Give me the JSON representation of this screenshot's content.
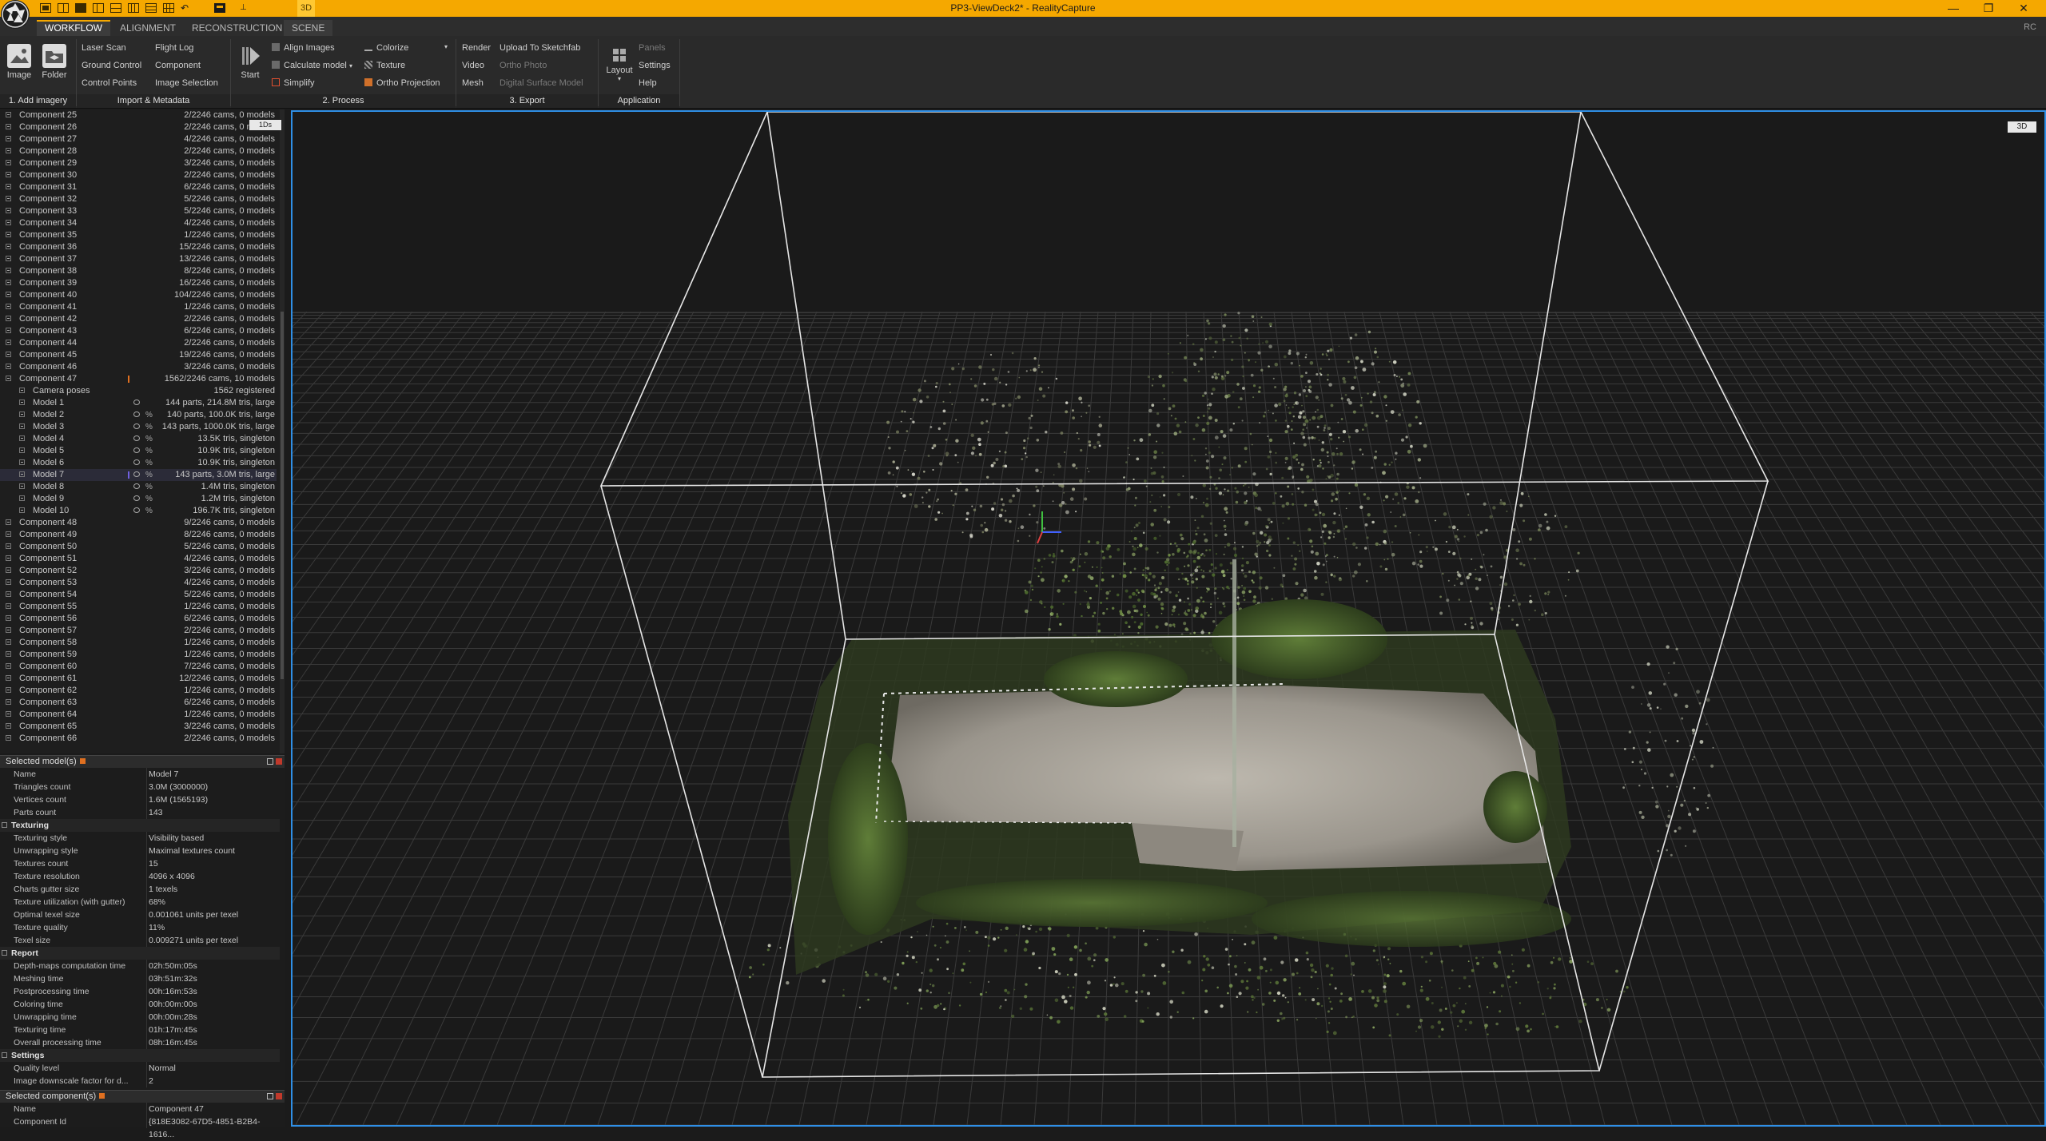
{
  "window": {
    "title": "PP3-ViewDeck2* - RealityCapture",
    "view_mode": "3D"
  },
  "tabs": [
    "WORKFLOW",
    "ALIGNMENT",
    "RECONSTRUCTION",
    "SCENE"
  ],
  "active_tab": "WORKFLOW",
  "rc_label": "RC",
  "ribbon": {
    "add_imagery": {
      "image": "Image",
      "folder": "Folder",
      "label": "1. Add imagery"
    },
    "import_metadata": {
      "col1": [
        "Laser Scan",
        "Ground Control",
        "Control Points"
      ],
      "col2": [
        "Flight Log",
        "Component",
        "Image Selection"
      ],
      "label": "Import & Metadata"
    },
    "process": {
      "start": "Start",
      "col1": [
        "Align Images",
        "Calculate model",
        "Simplify"
      ],
      "col2": [
        "Colorize",
        "Texture",
        "Ortho Projection"
      ],
      "label": "2. Process"
    },
    "export": {
      "col1": [
        "Render",
        "Video",
        "Mesh"
      ],
      "col2": [
        "Upload To Sketchfab",
        "Ortho Photo",
        "Digital Surface Model"
      ],
      "label": "3. Export"
    },
    "application": {
      "layout": "Layout",
      "col": [
        "Panels",
        "Settings",
        "Help"
      ],
      "label": "Application"
    }
  },
  "tree": {
    "badge": "1Ds",
    "rows": [
      {
        "name": "Component 25",
        "value": "2/2246 cams, 0 models"
      },
      {
        "name": "Component 26",
        "value": "2/2246 cams, 0 models"
      },
      {
        "name": "Component 27",
        "value": "4/2246 cams, 0 models"
      },
      {
        "name": "Component 28",
        "value": "2/2246 cams, 0 models"
      },
      {
        "name": "Component 29",
        "value": "3/2246 cams, 0 models"
      },
      {
        "name": "Component 30",
        "value": "2/2246 cams, 0 models"
      },
      {
        "name": "Component 31",
        "value": "6/2246 cams, 0 models"
      },
      {
        "name": "Component 32",
        "value": "5/2246 cams, 0 models"
      },
      {
        "name": "Component 33",
        "value": "5/2246 cams, 0 models"
      },
      {
        "name": "Component 34",
        "value": "4/2246 cams, 0 models"
      },
      {
        "name": "Component 35",
        "value": "1/2246 cams, 0 models"
      },
      {
        "name": "Component 36",
        "value": "15/2246 cams, 0 models"
      },
      {
        "name": "Component 37",
        "value": "13/2246 cams, 0 models"
      },
      {
        "name": "Component 38",
        "value": "8/2246 cams, 0 models"
      },
      {
        "name": "Component 39",
        "value": "16/2246 cams, 0 models"
      },
      {
        "name": "Component 40",
        "value": "104/2246 cams, 0 models"
      },
      {
        "name": "Component 41",
        "value": "1/2246 cams, 0 models"
      },
      {
        "name": "Component 42",
        "value": "2/2246 cams, 0 models"
      },
      {
        "name": "Component 43",
        "value": "6/2246 cams, 0 models"
      },
      {
        "name": "Component 44",
        "value": "2/2246 cams, 0 models"
      },
      {
        "name": "Component 45",
        "value": "19/2246 cams, 0 models"
      },
      {
        "name": "Component 46",
        "value": "3/2246 cams, 0 models"
      },
      {
        "name": "Component 47",
        "value": "1562/2246 cams, 10 models"
      },
      {
        "name": "Camera poses",
        "value": "1562 registered",
        "sub": true
      },
      {
        "name": "Model 1",
        "value": "144 parts, 214.8M tris, large",
        "sub": true,
        "eye": true
      },
      {
        "name": "Model 2",
        "value": "140 parts, 100.0K tris, large",
        "sub": true,
        "eye": true,
        "pct": true
      },
      {
        "name": "Model 3",
        "value": "143 parts, 1000.0K tris, large",
        "sub": true,
        "eye": true,
        "pct": true
      },
      {
        "name": "Model 4",
        "value": "13.5K tris, singleton",
        "sub": true,
        "eye": true,
        "pct": true
      },
      {
        "name": "Model 5",
        "value": "10.9K tris, singleton",
        "sub": true,
        "eye": true,
        "pct": true
      },
      {
        "name": "Model 6",
        "value": "10.9K tris, singleton",
        "sub": true,
        "eye": true,
        "pct": true
      },
      {
        "name": "Model 7",
        "value": "143 parts, 3.0M tris, large",
        "sub": true,
        "eye": true,
        "pct": true,
        "selected": true
      },
      {
        "name": "Model 8",
        "value": "1.4M tris, singleton",
        "sub": true,
        "eye": true,
        "pct": true
      },
      {
        "name": "Model 9",
        "value": "1.2M tris, singleton",
        "sub": true,
        "eye": true,
        "pct": true
      },
      {
        "name": "Model 10",
        "value": "196.7K tris, singleton",
        "sub": true,
        "eye": true,
        "pct": true
      },
      {
        "name": "Component 48",
        "value": "9/2246 cams, 0 models"
      },
      {
        "name": "Component 49",
        "value": "8/2246 cams, 0 models"
      },
      {
        "name": "Component 50",
        "value": "5/2246 cams, 0 models"
      },
      {
        "name": "Component 51",
        "value": "4/2246 cams, 0 models"
      },
      {
        "name": "Component 52",
        "value": "3/2246 cams, 0 models"
      },
      {
        "name": "Component 53",
        "value": "4/2246 cams, 0 models"
      },
      {
        "name": "Component 54",
        "value": "5/2246 cams, 0 models"
      },
      {
        "name": "Component 55",
        "value": "1/2246 cams, 0 models"
      },
      {
        "name": "Component 56",
        "value": "6/2246 cams, 0 models"
      },
      {
        "name": "Component 57",
        "value": "2/2246 cams, 0 models"
      },
      {
        "name": "Component 58",
        "value": "1/2246 cams, 0 models"
      },
      {
        "name": "Component 59",
        "value": "1/2246 cams, 0 models"
      },
      {
        "name": "Component 60",
        "value": "7/2246 cams, 0 models"
      },
      {
        "name": "Component 61",
        "value": "12/2246 cams, 0 models"
      },
      {
        "name": "Component 62",
        "value": "1/2246 cams, 0 models"
      },
      {
        "name": "Component 63",
        "value": "6/2246 cams, 0 models"
      },
      {
        "name": "Component 64",
        "value": "1/2246 cams, 0 models"
      },
      {
        "name": "Component 65",
        "value": "3/2246 cams, 0 models"
      },
      {
        "name": "Component 66",
        "value": "2/2246 cams, 0 models"
      }
    ]
  },
  "selected_model": {
    "header": "Selected model(s)",
    "props": [
      {
        "k": "Name",
        "v": "Model 7"
      },
      {
        "k": "Triangles count",
        "v": "3.0M (3000000)"
      },
      {
        "k": "Vertices count",
        "v": "1.6M (1565193)"
      },
      {
        "k": "Parts count",
        "v": "143"
      },
      {
        "k": "Texturing",
        "group": true
      },
      {
        "k": "Texturing style",
        "v": "Visibility based"
      },
      {
        "k": "Unwrapping style",
        "v": "Maximal textures count"
      },
      {
        "k": "Textures count",
        "v": "15"
      },
      {
        "k": "Texture resolution",
        "v": "4096 x 4096"
      },
      {
        "k": "Charts gutter size",
        "v": "1 texels"
      },
      {
        "k": "Texture utilization (with gutter)",
        "v": "68%"
      },
      {
        "k": "Optimal texel size",
        "v": "0.001061 units per texel"
      },
      {
        "k": "Texture quality",
        "v": "11%"
      },
      {
        "k": "Texel size",
        "v": "0.009271 units per texel"
      },
      {
        "k": "Report",
        "group": true
      },
      {
        "k": "Depth-maps computation time",
        "v": "02h:50m:05s"
      },
      {
        "k": "Meshing time",
        "v": "03h:51m:32s"
      },
      {
        "k": "Postprocessing time",
        "v": "00h:16m:53s"
      },
      {
        "k": "Coloring time",
        "v": "00h:00m:00s"
      },
      {
        "k": "Unwrapping time",
        "v": "00h:00m:28s"
      },
      {
        "k": "Texturing time",
        "v": "01h:17m:45s"
      },
      {
        "k": "Overall processing time",
        "v": "08h:16m:45s"
      },
      {
        "k": "Settings",
        "group": true
      },
      {
        "k": "Quality level",
        "v": "Normal"
      },
      {
        "k": "Image downscale factor for d...",
        "v": "2"
      }
    ]
  },
  "selected_component": {
    "header": "Selected component(s)",
    "props": [
      {
        "k": "Name",
        "v": "Component 47"
      },
      {
        "k": "Component Id",
        "v": "{818E3082-67D5-4851-B2B4-1616..."
      }
    ]
  },
  "viewport": {
    "badge": "3D"
  },
  "colors": {
    "accent": "#f5a800",
    "viewport_border": "#2f8fe6",
    "panel_bg": "#1e1e1e"
  }
}
